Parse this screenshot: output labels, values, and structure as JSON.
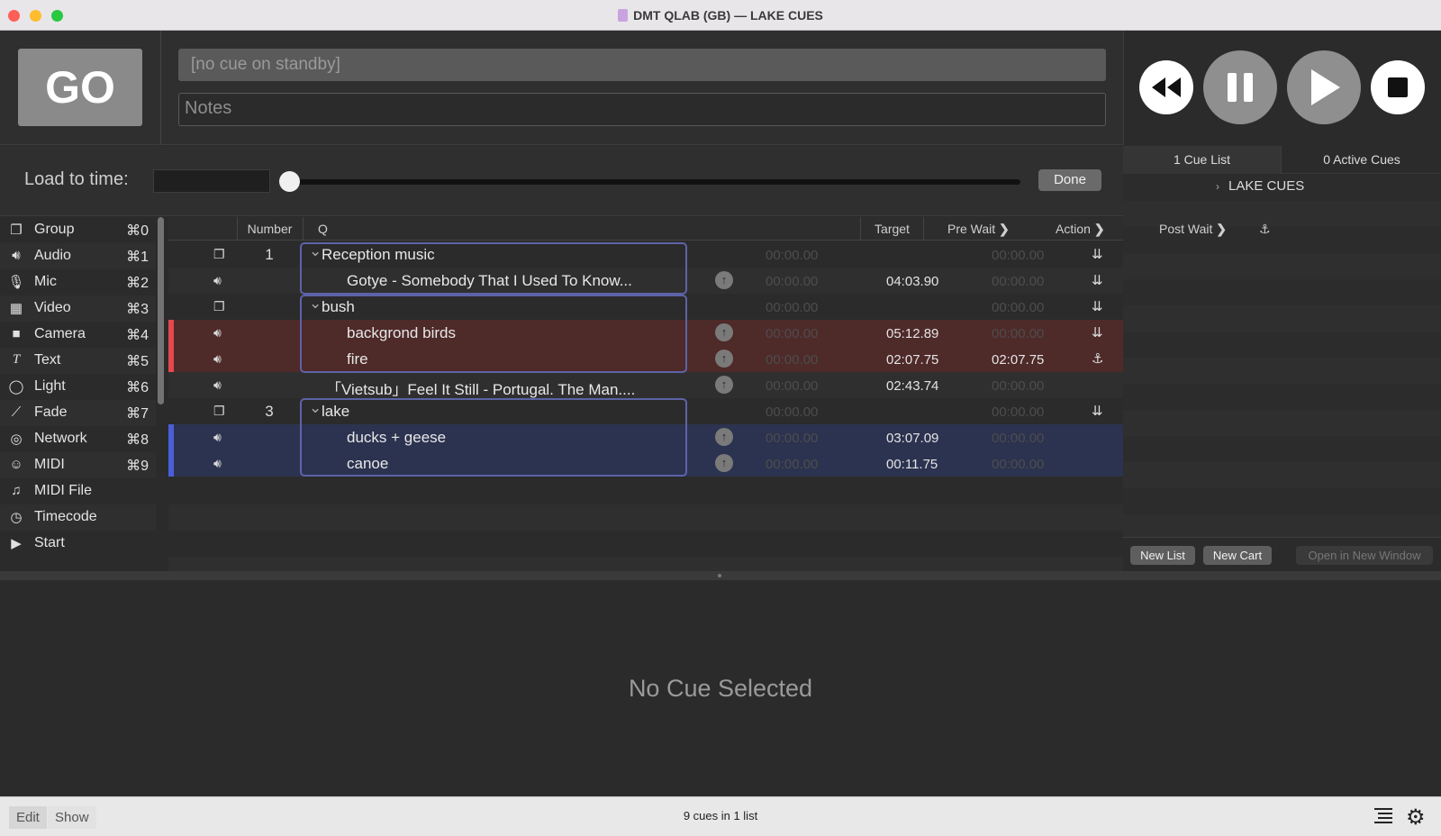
{
  "window": {
    "title": "DMT QLAB (GB) — LAKE CUES"
  },
  "go": {
    "label": "GO"
  },
  "standby": {
    "text": "[no cue on standby]"
  },
  "notes": {
    "placeholder": "Notes"
  },
  "load": {
    "label": "Load to time:",
    "done_label": "Done",
    "slider_position": 0
  },
  "lists_panel": {
    "tab_lists": "1 Cue List",
    "tab_active": "0 Active Cues",
    "lists": [
      {
        "name": "LAKE CUES"
      }
    ],
    "new_list": "New List",
    "new_cart": "New Cart",
    "open_window": "Open in New Window"
  },
  "toolbox": [
    {
      "label": "Group",
      "shortcut": "⌘0",
      "icon": "group-icon"
    },
    {
      "label": "Audio",
      "shortcut": "⌘1",
      "icon": "audio-icon"
    },
    {
      "label": "Mic",
      "shortcut": "⌘2",
      "icon": "mic-icon"
    },
    {
      "label": "Video",
      "shortcut": "⌘3",
      "icon": "video-icon"
    },
    {
      "label": "Camera",
      "shortcut": "⌘4",
      "icon": "camera-icon"
    },
    {
      "label": "Text",
      "shortcut": "⌘5",
      "icon": "text-icon"
    },
    {
      "label": "Light",
      "shortcut": "⌘6",
      "icon": "light-icon"
    },
    {
      "label": "Fade",
      "shortcut": "⌘7",
      "icon": "fade-icon"
    },
    {
      "label": "Network",
      "shortcut": "⌘8",
      "icon": "network-icon"
    },
    {
      "label": "MIDI",
      "shortcut": "⌘9",
      "icon": "midi-icon"
    },
    {
      "label": "MIDI File",
      "shortcut": "",
      "icon": "midi-file-icon"
    },
    {
      "label": "Timecode",
      "shortcut": "",
      "icon": "timecode-icon"
    },
    {
      "label": "Start",
      "shortcut": "",
      "icon": "start-icon"
    }
  ],
  "table": {
    "headers": {
      "number": "Number",
      "q": "Q",
      "target": "Target",
      "pre_wait": "Pre Wait",
      "action": "Action",
      "post_wait": "Post Wait"
    },
    "rows": [
      {
        "type": "group",
        "number": "1",
        "name": "Reception music",
        "pre": "00:00.00",
        "action": "",
        "post": "00:00.00",
        "color": "",
        "continue": "auto-follow",
        "has_target": false
      },
      {
        "type": "audio",
        "number": "",
        "name": "Gotye - Somebody That I Used To Know...",
        "pre": "00:00.00",
        "action": "04:03.90",
        "post": "00:00.00",
        "color": "",
        "continue": "auto-follow",
        "has_target": true
      },
      {
        "type": "group",
        "number": "",
        "name": "bush",
        "pre": "00:00.00",
        "action": "",
        "post": "00:00.00",
        "color": "",
        "continue": "auto-follow",
        "has_target": false
      },
      {
        "type": "audio",
        "number": "",
        "name": "backgrond birds",
        "pre": "00:00.00",
        "action": "05:12.89",
        "post": "00:00.00",
        "color": "red",
        "continue": "auto-follow",
        "has_target": true
      },
      {
        "type": "audio",
        "number": "",
        "name": "fire",
        "pre": "00:00.00",
        "action": "02:07.75",
        "post": "02:07.75",
        "color": "red",
        "continue": "auto-continue",
        "has_target": true
      },
      {
        "type": "audio",
        "number": "",
        "name": "「Vietsub」Feel It Still - Portugal. The Man....",
        "pre": "00:00.00",
        "action": "02:43.74",
        "post": "00:00.00",
        "color": "",
        "continue": "",
        "has_target": true
      },
      {
        "type": "group",
        "number": "3",
        "name": "lake",
        "pre": "00:00.00",
        "action": "",
        "post": "00:00.00",
        "color": "",
        "continue": "auto-follow",
        "has_target": false
      },
      {
        "type": "audio",
        "number": "",
        "name": "ducks + geese",
        "pre": "00:00.00",
        "action": "03:07.09",
        "post": "00:00.00",
        "color": "blue",
        "continue": "",
        "has_target": true
      },
      {
        "type": "audio",
        "number": "",
        "name": "canoe",
        "pre": "00:00.00",
        "action": "00:11.75",
        "post": "00:00.00",
        "color": "blue",
        "continue": "",
        "has_target": true
      }
    ]
  },
  "inspector": {
    "empty": "No Cue Selected"
  },
  "statusbar": {
    "edit": "Edit",
    "show": "Show",
    "text": "9 cues in 1 list"
  },
  "colors": {
    "red_row": "#4e2a29",
    "blue_row": "#2c3350",
    "red_stripe": "#e5484d",
    "blue_stripe": "#4a5ed8",
    "group_outline": "#5d63a8"
  }
}
